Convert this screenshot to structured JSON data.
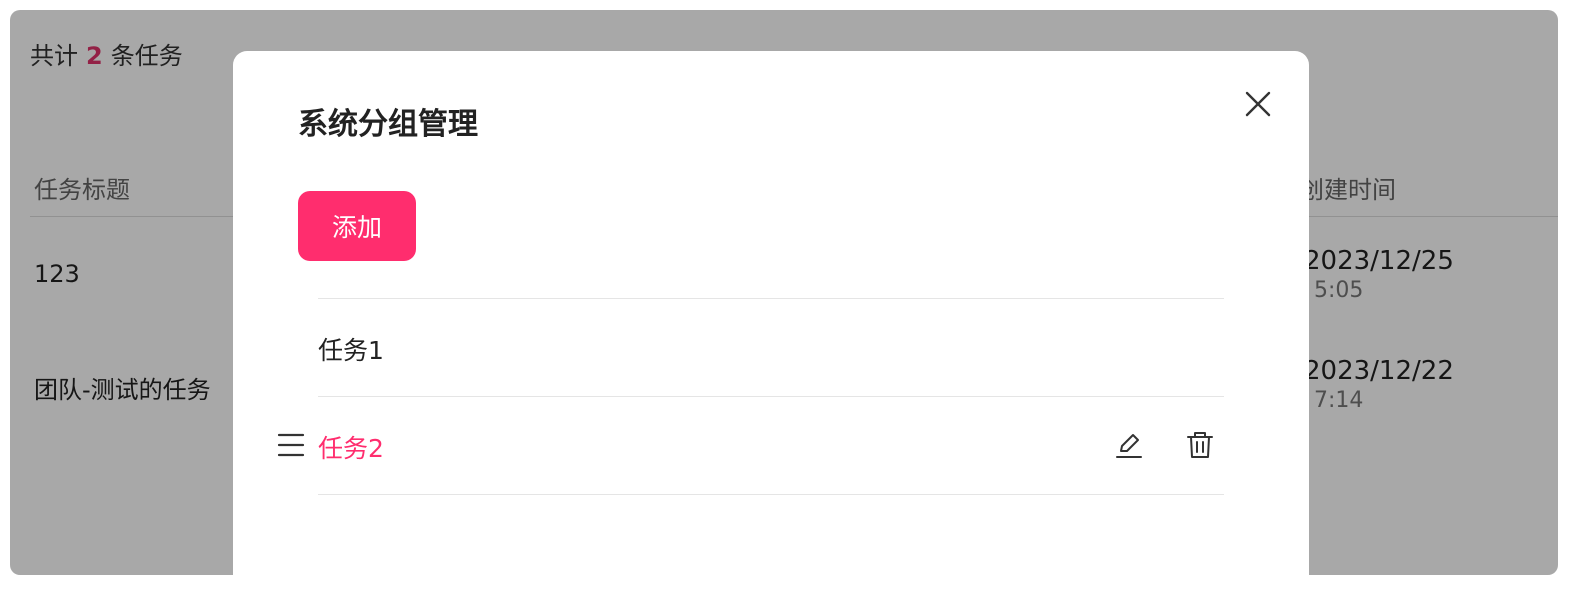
{
  "background": {
    "count_prefix": "共计",
    "count_value": "2",
    "count_suffix": "条任务",
    "columns": {
      "title": "任务标题",
      "created": "创建时间"
    },
    "rows": [
      {
        "title": "123",
        "date": "2023/12/25",
        "time": "5:05"
      },
      {
        "title": "团队-测试的任务",
        "date": "2023/12/22",
        "time": "7:14"
      }
    ]
  },
  "modal": {
    "title": "系统分组管理",
    "add_label": "添加",
    "groups": [
      {
        "label": "任务1"
      },
      {
        "label": "任务2"
      }
    ]
  },
  "icons": {
    "close": "close-icon",
    "drag": "drag-handle-icon",
    "edit": "edit-icon",
    "delete": "trash-icon"
  },
  "colors": {
    "accent": "#ff2d6e",
    "count": "#e0336b",
    "overlay": "rgba(0,0,0,0.34)"
  }
}
